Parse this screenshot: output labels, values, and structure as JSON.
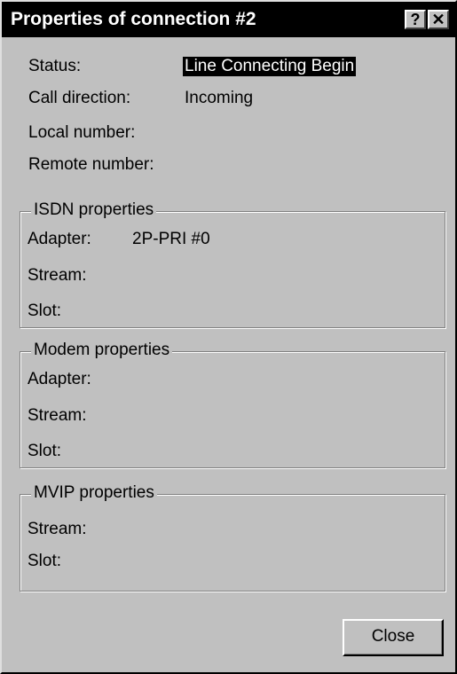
{
  "window": {
    "title": "Properties of connection #2",
    "help_glyph": "?",
    "close_glyph": "✕"
  },
  "connection": {
    "status_label": "Status:",
    "status_value": "Line Connecting Begin",
    "direction_label": "Call direction:",
    "direction_value": "Incoming",
    "local_label": "Local number:",
    "local_value": "",
    "remote_label": "Remote number:",
    "remote_value": ""
  },
  "isdn": {
    "legend": "ISDN properties",
    "adapter_label": "Adapter:",
    "adapter_value": "2P-PRI #0",
    "stream_label": "Stream:",
    "stream_value": "",
    "slot_label": "Slot:",
    "slot_value": ""
  },
  "modem": {
    "legend": "Modem properties",
    "adapter_label": "Adapter:",
    "adapter_value": "",
    "stream_label": "Stream:",
    "stream_value": "",
    "slot_label": "Slot:",
    "slot_value": ""
  },
  "mvip": {
    "legend": "MVIP properties",
    "stream_label": "Stream:",
    "stream_value": "",
    "slot_label": "Slot:",
    "slot_value": ""
  },
  "buttons": {
    "close_label": "Close"
  },
  "colors": {
    "face": "#c0c0c0",
    "titlebar": "#000000",
    "title_text": "#ffffff",
    "highlight_bg": "#000000",
    "highlight_text": "#ffffff"
  }
}
